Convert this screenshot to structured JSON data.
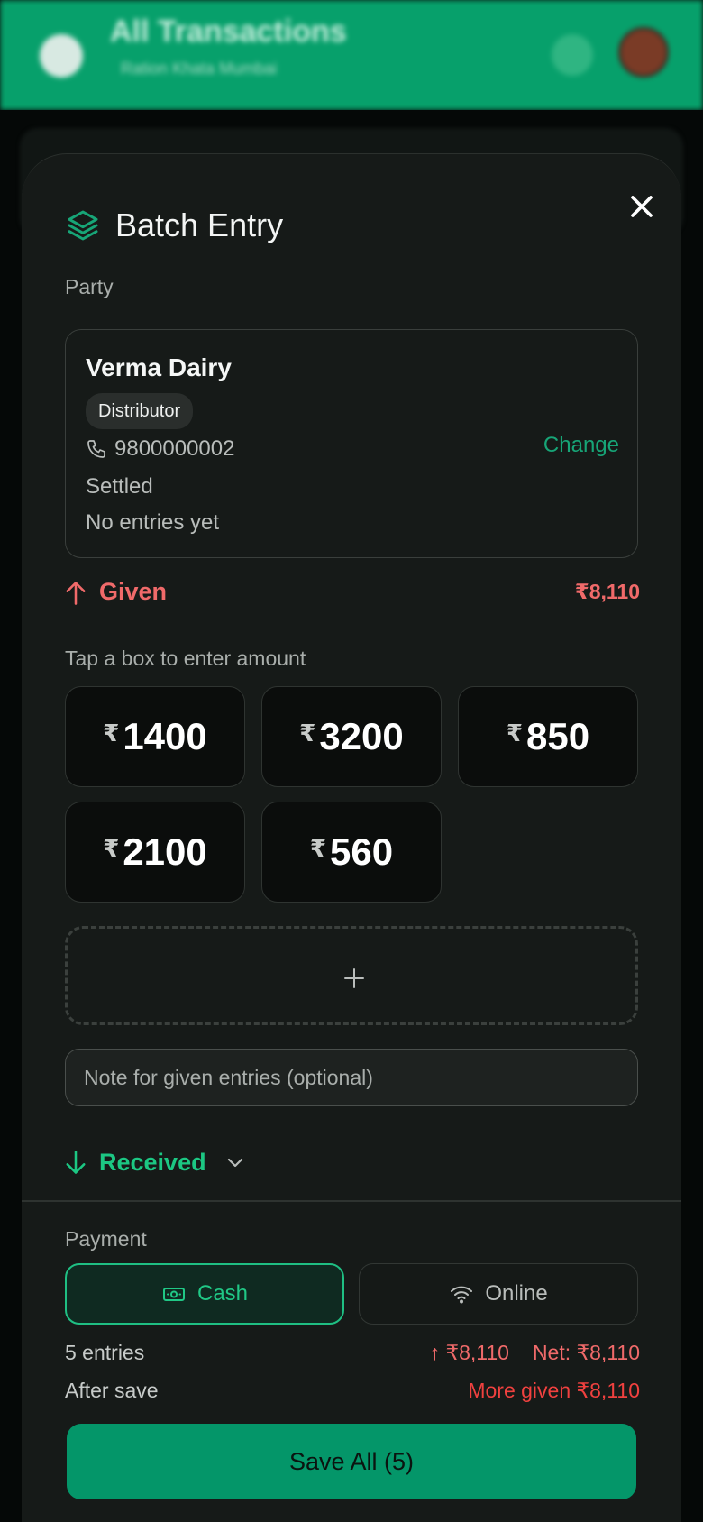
{
  "background": {
    "header_title": "All Transactions",
    "header_subtitle": "Ration Khata  Mumbai"
  },
  "sheet": {
    "title": "Batch Entry",
    "icons": {
      "title": "layers-icon",
      "close": "close-icon"
    }
  },
  "party": {
    "section_label": "Party",
    "name": "Verma Dairy",
    "badge": "Distributor",
    "phone": "9800000002",
    "status": "Settled",
    "entries_text": "No entries yet",
    "change_label": "Change"
  },
  "given": {
    "label": "Given",
    "total": "₹8,110",
    "hint": "Tap a box to enter amount",
    "currency_symbol": "₹",
    "amounts": [
      "1400",
      "3200",
      "850",
      "2100",
      "560"
    ],
    "note_placeholder": "Note for given entries (optional)",
    "note_value": ""
  },
  "received": {
    "label": "Received"
  },
  "payment": {
    "section_label": "Payment",
    "options": [
      {
        "label": "Cash",
        "icon": "cash-icon",
        "selected": true
      },
      {
        "label": "Online",
        "icon": "wifi-icon",
        "selected": false
      }
    ]
  },
  "summary": {
    "entries_count": "5 entries",
    "given_total": "↑ ₹8,110",
    "net": "Net: ₹8,110",
    "after_save_label": "After save",
    "after_save_value": "More given ₹8,110"
  },
  "save_button": "Save All (5)",
  "colors": {
    "accent_green": "#17a577",
    "given_red": "#f06a6a",
    "after_save_red": "#f0413f",
    "received_green": "#1cc783",
    "save_button_bg": "#049669",
    "sheet_bg": "#161a18",
    "header_bg": "#07a06b"
  }
}
